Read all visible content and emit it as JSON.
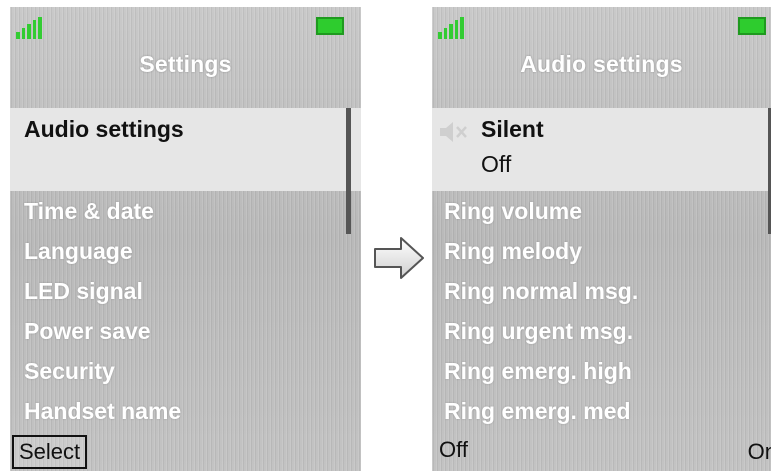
{
  "left_screen": {
    "icons": {
      "signal": "signal-strength-icon",
      "battery": "battery-icon"
    },
    "title": "Settings",
    "selected_item": "Audio settings",
    "items": [
      {
        "label": "Time & date"
      },
      {
        "label": "Language"
      },
      {
        "label": "LED signal"
      },
      {
        "label": "Power save"
      },
      {
        "label": "Security"
      },
      {
        "label": "Handset name"
      }
    ],
    "softkey_left": "Select"
  },
  "arrow": {
    "icon": "right-arrow-icon"
  },
  "right_screen": {
    "icons": {
      "signal": "signal-strength-icon",
      "battery": "battery-icon",
      "mute": "mute-speaker-icon"
    },
    "title": "Audio settings",
    "selected_item": {
      "label": "Silent",
      "value": "Off"
    },
    "items": [
      {
        "label": "Ring volume"
      },
      {
        "label": "Ring melody"
      },
      {
        "label": "Ring normal msg."
      },
      {
        "label": "Ring urgent msg."
      },
      {
        "label": "Ring emerg. high"
      },
      {
        "label": "Ring emerg. med"
      }
    ],
    "softkey_left": "Off",
    "softkey_right": "On"
  },
  "colors": {
    "signal": "#33cc33",
    "battery": "#2ecc2e",
    "selection": "#e6e6e6",
    "menu_text": "#ffffff",
    "selected_text": "#111111"
  }
}
